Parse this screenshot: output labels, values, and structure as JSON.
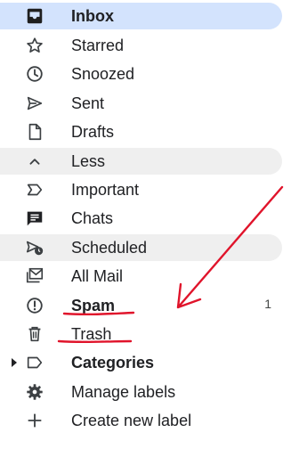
{
  "nav": {
    "items": [
      {
        "label": "Inbox",
        "icon": "inbox-icon",
        "bold": true
      },
      {
        "label": "Starred",
        "icon": "star-icon"
      },
      {
        "label": "Snoozed",
        "icon": "clock-icon"
      },
      {
        "label": "Sent",
        "icon": "send-icon"
      },
      {
        "label": "Drafts",
        "icon": "draft-icon"
      },
      {
        "label": "Less",
        "icon": "chevron-up-icon"
      },
      {
        "label": "Important",
        "icon": "important-icon"
      },
      {
        "label": "Chats",
        "icon": "chat-icon"
      },
      {
        "label": "Scheduled",
        "icon": "scheduled-icon"
      },
      {
        "label": "All Mail",
        "icon": "all-mail-icon"
      },
      {
        "label": "Spam",
        "icon": "spam-icon",
        "bold": true,
        "count": "1"
      },
      {
        "label": "Trash",
        "icon": "trash-icon"
      },
      {
        "label": "Categories",
        "icon": "label-icon",
        "bold": true
      },
      {
        "label": "Manage labels",
        "icon": "gear-icon"
      },
      {
        "label": "Create new label",
        "icon": "plus-icon"
      }
    ]
  },
  "colors": {
    "active_bg": "#d3e3fd",
    "highlight_bg": "#efefef",
    "annotation_red": "#e0142b"
  }
}
